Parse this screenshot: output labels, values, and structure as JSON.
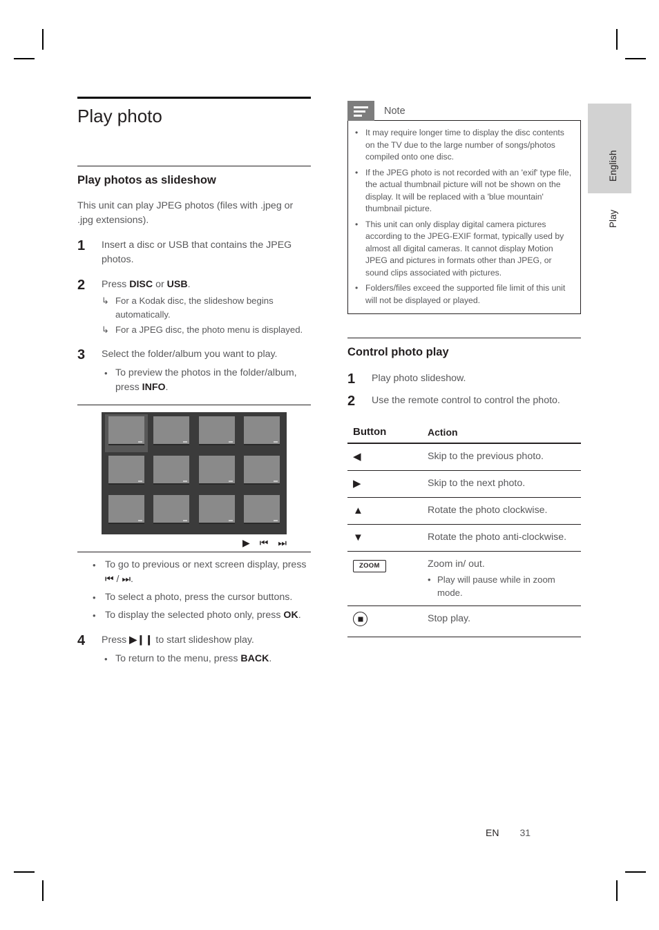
{
  "page": {
    "language_tab": "English",
    "section_tab": "Play",
    "footer_lang": "EN",
    "footer_page": "31"
  },
  "left": {
    "chapter_title": "Play photo",
    "section_title": "Play photos as slideshow",
    "intro": "This unit can play JPEG photos (files with .jpeg or .jpg extensions).",
    "steps": [
      {
        "num": "1",
        "text": "Insert a disc or USB that contains the JPEG photos."
      },
      {
        "num": "2",
        "text_pre": "Press ",
        "bold1": "DISC",
        "text_mid": " or ",
        "bold2": "USB",
        "text_post": ".",
        "results": [
          "For a Kodak disc, the slideshow begins automatically.",
          "For a JPEG disc, the photo menu is displayed."
        ]
      },
      {
        "num": "3",
        "text": "Select the folder/album you want to play.",
        "bullets": [
          {
            "pre": "To preview the photos in the folder/album, press ",
            "bold": "INFO",
            "post": "."
          }
        ]
      },
      {
        "num": "4",
        "text_pre": "Press ",
        "key": "▶❙❙",
        "text_post": " to start slideshow play.",
        "bullets": [
          {
            "pre": "To return to the menu, press ",
            "bold": "BACK",
            "post": "."
          }
        ]
      }
    ],
    "figure": {
      "caption": "",
      "control_icons": [
        "play-icon",
        "previous-icon",
        "next-icon"
      ],
      "control_glyphs": [
        "▶",
        "⏮",
        "⏭"
      ],
      "thumbnails": [
        {
          "id": "thumb-1",
          "selected": true,
          "texture": "tx1"
        },
        {
          "id": "thumb-2",
          "selected": false,
          "texture": "tx2"
        },
        {
          "id": "thumb-3",
          "selected": false,
          "texture": "tx3"
        },
        {
          "id": "thumb-4",
          "selected": false,
          "texture": "tx4"
        },
        {
          "id": "thumb-5",
          "selected": false,
          "texture": "tx5"
        },
        {
          "id": "thumb-6",
          "selected": false,
          "texture": "tx6"
        },
        {
          "id": "thumb-7",
          "selected": false,
          "texture": "tx7"
        },
        {
          "id": "thumb-8",
          "selected": false,
          "texture": "tx8"
        },
        {
          "id": "thumb-9",
          "selected": false,
          "texture": "tx9"
        },
        {
          "id": "thumb-10",
          "selected": false,
          "texture": "tx10"
        },
        {
          "id": "thumb-11",
          "selected": false,
          "texture": "tx11"
        },
        {
          "id": "thumb-12",
          "selected": false,
          "texture": "tx12"
        }
      ]
    },
    "after_figure_bullets": [
      {
        "pre": "To go to previous or next screen display, press ",
        "glyph1": "⏮",
        "sep": " / ",
        "glyph2": "⏭",
        "post": "."
      },
      {
        "pre": "To select a photo, press the cursor buttons.",
        "bold": "",
        "post": ""
      },
      {
        "pre": "To display the selected photo only, press ",
        "bold": "OK",
        "post": "."
      }
    ]
  },
  "right": {
    "note": {
      "icon": "note-icon",
      "title": "Note",
      "items": [
        "It may require longer time to display the disc contents on the TV due to the large number of songs/photos compiled onto one disc.",
        "If the JPEG photo is not recorded with an 'exif' type file, the actual thumbnail picture will not be shown on the display.  It will be replaced with a 'blue mountain' thumbnail picture.",
        "This unit can only display digital camera pictures according to the JPEG-EXIF format, typically used by almost all digital cameras.  It cannot display Motion JPEG and pictures in formats other than JPEG, or sound clips associated with pictures.",
        "Folders/files exceed the supported file limit of this unit will not be displayed or played."
      ]
    },
    "section_title": "Control photo play",
    "steps": [
      {
        "num": "1",
        "text": "Play photo slideshow."
      },
      {
        "num": "2",
        "text": "Use the remote control to control the photo."
      }
    ],
    "table": {
      "headers": [
        "Button",
        "Action"
      ],
      "rows": [
        {
          "button_icon": "left-arrow-icon",
          "button_glyph": "◀",
          "action": "Skip to the previous photo."
        },
        {
          "button_icon": "right-arrow-icon",
          "button_glyph": "▶",
          "action": "Skip to the next photo."
        },
        {
          "button_icon": "up-arrow-icon",
          "button_glyph": "▲",
          "action": "Rotate the photo clockwise."
        },
        {
          "button_icon": "down-arrow-icon",
          "button_glyph": "▼",
          "action": "Rotate the photo anti-clockwise."
        },
        {
          "button_icon": "zoom-key-icon",
          "button_label": "ZOOM",
          "action": "Zoom in/ out.",
          "sub": "Play will pause while in zoom mode."
        },
        {
          "button_icon": "stop-key-icon",
          "button_glyph": "",
          "action": "Stop play."
        }
      ]
    }
  },
  "colors": {
    "body_text": "#58585a",
    "heading_text": "#231f20",
    "note_icon_bg": "#7d7d7d",
    "side_tab_bg": "#d2d2d2",
    "tv_bg": "#3b3b3b"
  }
}
